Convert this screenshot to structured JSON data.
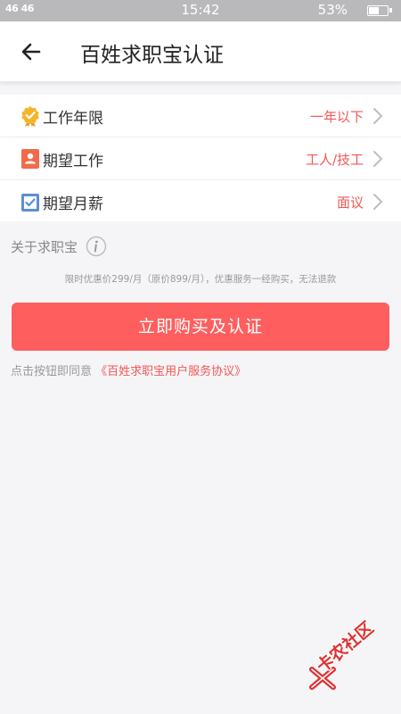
{
  "status_bar": {
    "signal": "46 46",
    "time": "15:42",
    "battery": "53%"
  },
  "header": {
    "title": "百姓求职宝认证"
  },
  "list": {
    "items": [
      {
        "label": "工作年限",
        "value": "一年以下",
        "icon": "medal-icon",
        "icon_color": "#f5b52a"
      },
      {
        "label": "期望工作",
        "value": "工人/技工",
        "icon": "person-card-icon",
        "icon_color": "#f26a4a"
      },
      {
        "label": "期望月薪",
        "value": "面议",
        "icon": "checkbox-icon",
        "icon_color": "#5b8ed6"
      }
    ]
  },
  "about": {
    "label": "关于求职宝"
  },
  "promo": "限时优惠价299/月（原价899/月），优惠服务一经购买，无法退款",
  "buy_button": "立即购买及认证",
  "agreement": {
    "prefix": "点击按钮即同意",
    "link": "《百姓求职宝用户服务协议》"
  },
  "watermark": "卡农社区",
  "colors": {
    "accent": "#ff5e5e",
    "value_text": "#f25757",
    "background": "#f5f5f7"
  }
}
